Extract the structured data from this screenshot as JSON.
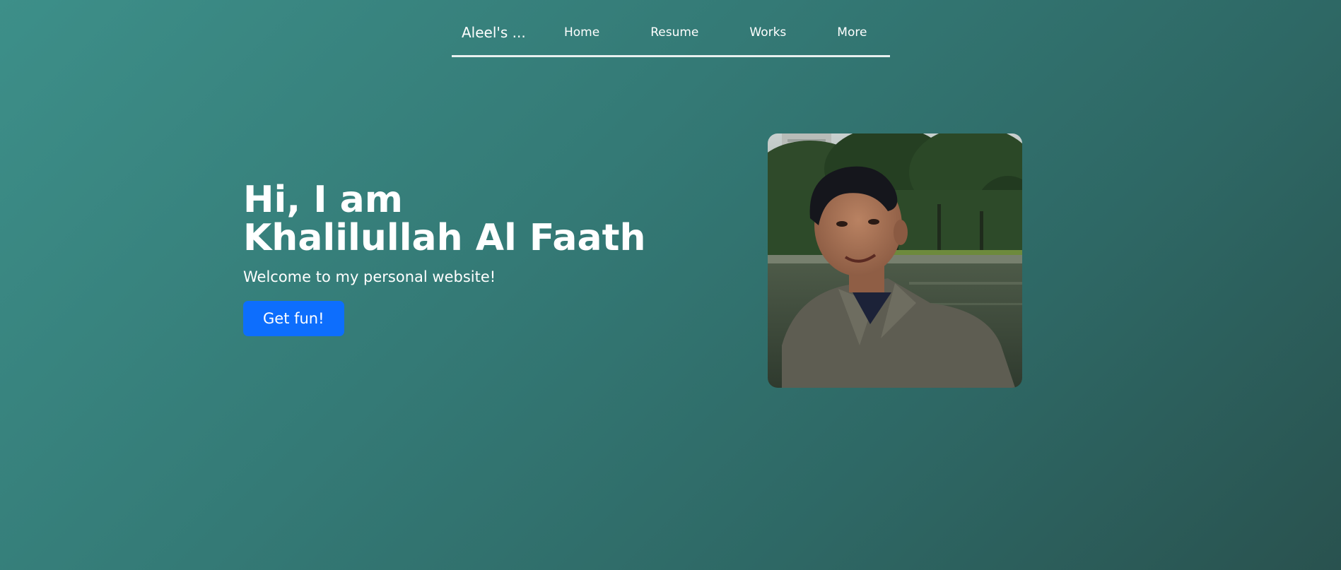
{
  "nav": {
    "brand": "Aleel's ...",
    "links": [
      "Home",
      "Resume",
      "Works",
      "More"
    ]
  },
  "hero": {
    "title_line1": "Hi, I am",
    "title_line2": "Khalilullah Al Faath",
    "subtitle": "Welcome to my personal website!",
    "button_label": "Get fun!"
  },
  "colors": {
    "background_start": "#3d8f89",
    "background_end": "#29524f",
    "button": "#0d6efd"
  }
}
